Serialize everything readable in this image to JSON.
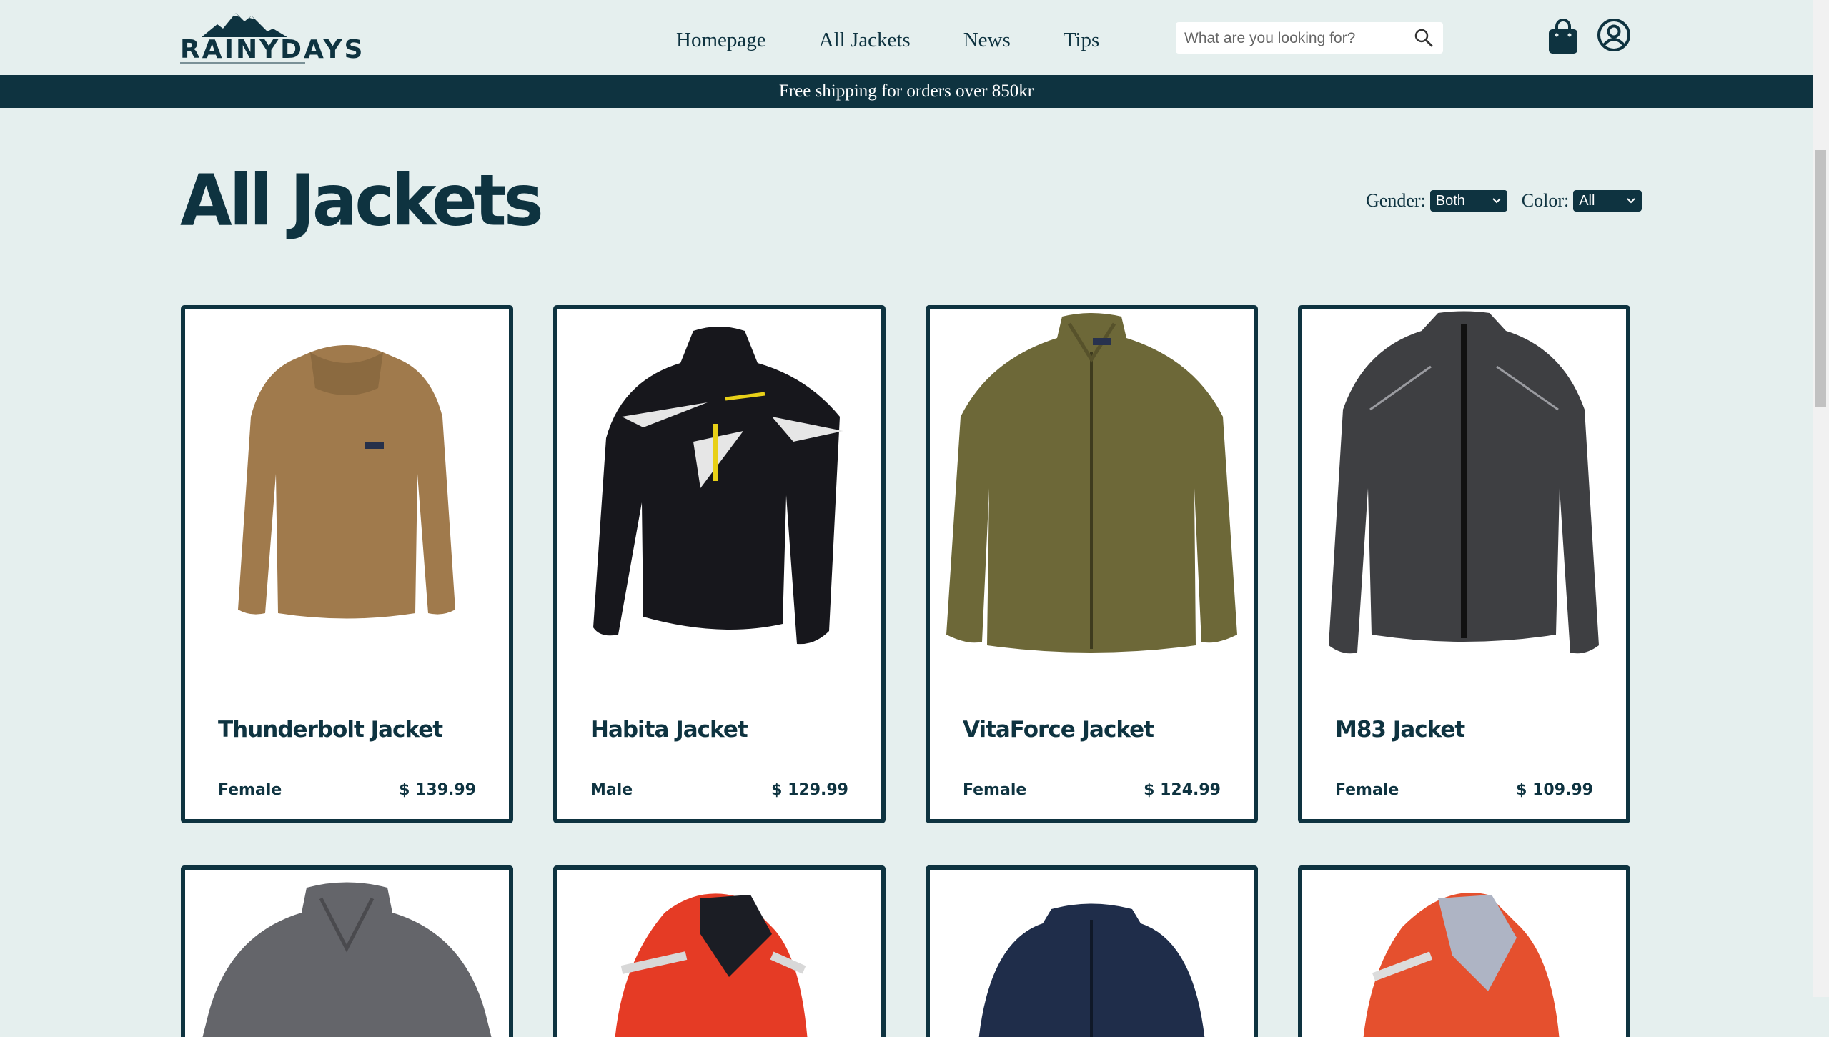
{
  "header": {
    "logo_text": "RAINYDAYS",
    "nav": [
      "Homepage",
      "All Jackets",
      "News",
      "Tips"
    ],
    "search_placeholder": "What are you looking for?"
  },
  "banner": {
    "text": "Free shipping for orders over 850kr"
  },
  "main": {
    "title": "All Jackets",
    "filters": {
      "gender_label": "Gender:",
      "gender_value": "Both",
      "color_label": "Color:",
      "color_value": "All"
    }
  },
  "products": [
    {
      "name": "Thunderbolt Jacket",
      "gender": "Female",
      "price": "$ 139.99",
      "color": "#a07a4c",
      "image": "teddy-fleece-jacket"
    },
    {
      "name": "Habita Jacket",
      "gender": "Male",
      "price": "$ 129.99",
      "color": "#17171c",
      "image": "black-ski-jacket"
    },
    {
      "name": "VitaForce Jacket",
      "gender": "Female",
      "price": "$ 124.99",
      "color": "#6d6838",
      "image": "olive-fleece-jacket"
    },
    {
      "name": "M83 Jacket",
      "gender": "Female",
      "price": "$ 109.99",
      "color": "#3e3f42",
      "image": "grey-shell-jacket"
    }
  ],
  "products_row2": [
    {
      "color": "#64656a",
      "image": "grey-jacket"
    },
    {
      "color": "#e53b25",
      "image": "red-sailing-jacket"
    },
    {
      "color": "#1f2d4a",
      "image": "navy-fleece-jacket"
    },
    {
      "color": "#e5502e",
      "image": "orange-sailing-jacket"
    }
  ],
  "colors": {
    "primary": "#0e3340",
    "background": "#e5efee",
    "card": "#ffffff"
  }
}
